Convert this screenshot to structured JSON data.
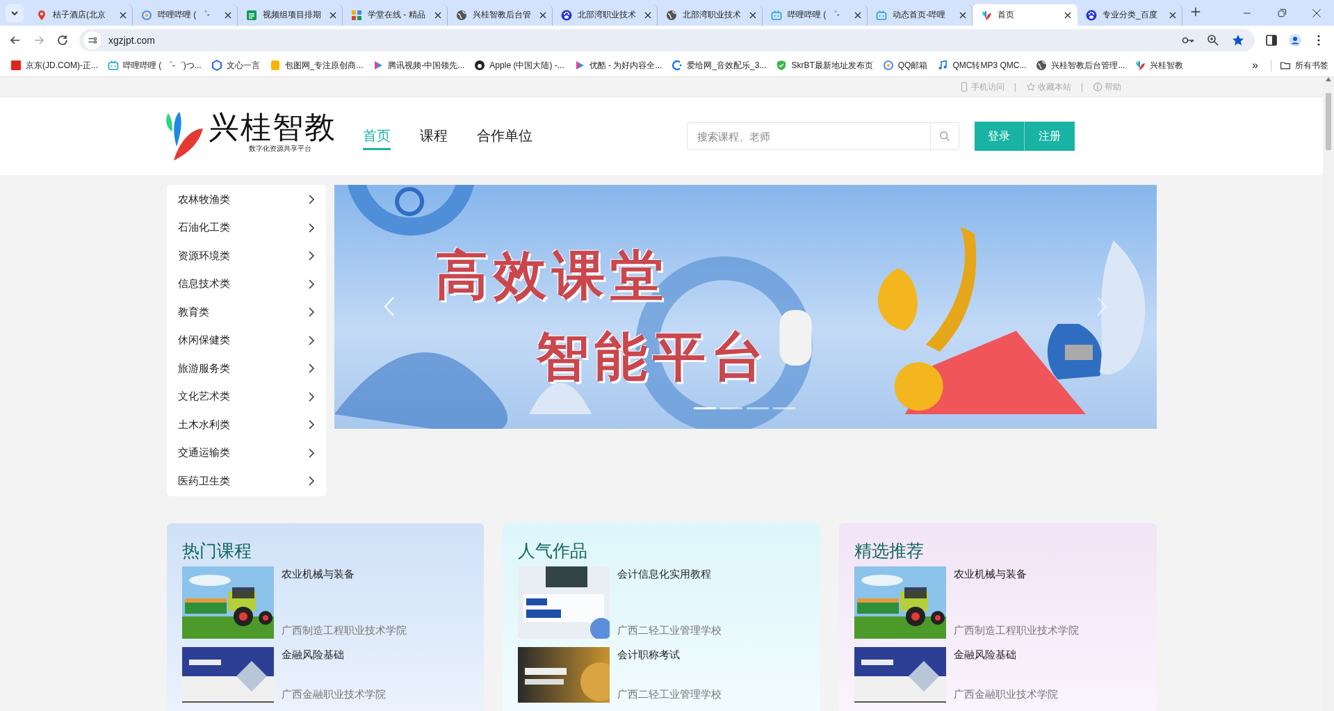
{
  "browser": {
    "tabs": [
      {
        "title": "桔子酒店(北京",
        "kind": "pin",
        "selected": false
      },
      {
        "title": "哔哩哔哩 ( ゜-",
        "kind": "ring",
        "selected": false
      },
      {
        "title": "视频组项目排期",
        "kind": "sheet",
        "selected": false
      },
      {
        "title": "学堂在线 - 精品",
        "kind": "grid",
        "selected": false
      },
      {
        "title": "兴桂智教后台管",
        "kind": "globe",
        "selected": false
      },
      {
        "title": "北部湾职业技术",
        "kind": "paw",
        "selected": false
      },
      {
        "title": "北部湾职业技术",
        "kind": "globe",
        "selected": false
      },
      {
        "title": "哔哩哔哩 ( ゜-",
        "kind": "tv",
        "selected": false
      },
      {
        "title": "动态首页-哔哩",
        "kind": "tv",
        "selected": false
      },
      {
        "title": "首页",
        "kind": "leaf",
        "selected": true
      },
      {
        "title": "专业分类_百度",
        "kind": "paw",
        "selected": false
      }
    ],
    "url": "xgzjpt.com",
    "bookmarks": [
      {
        "label": "京东(JD.COM)-正...",
        "kind": "square"
      },
      {
        "label": "哔哩哔哩 ( ゜-゜)つ...",
        "kind": "tv"
      },
      {
        "label": "文心一言",
        "kind": "cube"
      },
      {
        "label": "包图网_专注原创商...",
        "kind": "tile"
      },
      {
        "label": "腾讯视频-中国领先...",
        "kind": "play"
      },
      {
        "label": "Apple (中国大陆) -...",
        "kind": "dot"
      },
      {
        "label": "优酷 - 为好内容全...",
        "kind": "play"
      },
      {
        "label": "爱给网_音效配乐_3...",
        "kind": "arc"
      },
      {
        "label": "SkrBT最新地址发布页",
        "kind": "shield"
      },
      {
        "label": "QQ邮箱",
        "kind": "ring"
      },
      {
        "label": "QMC转MP3 QMC...",
        "kind": "note"
      },
      {
        "label": "兴桂智教后台管理...",
        "kind": "globe"
      },
      {
        "label": "兴桂智教",
        "kind": "leaf"
      }
    ],
    "more": "»",
    "all_bookmarks": "所有书签"
  },
  "topbar": {
    "links": [
      "手机访问",
      "收藏本站",
      "帮助"
    ],
    "separator": "|"
  },
  "header": {
    "logo": {
      "name": "兴桂智教",
      "tagline": "数字化资源共享平台"
    },
    "nav": [
      {
        "label": "首页",
        "selected": true
      },
      {
        "label": "课程",
        "selected": false
      },
      {
        "label": "合作单位",
        "selected": false
      }
    ],
    "search": {
      "placeholder": "搜索课程、老师"
    },
    "buttons": [
      "登录",
      "注册"
    ]
  },
  "categories": [
    "农林牧渔类",
    "石油化工类",
    "资源环境类",
    "信息技术类",
    "教育类",
    "休闲保健类",
    "旅游服务类",
    "文化艺术类",
    "土木水利类",
    "交通运输类",
    "医药卫生类"
  ],
  "banner": {
    "headline": [
      "高效课堂",
      "智能平台"
    ],
    "dots": [
      {
        "selected": true
      },
      {
        "selected": false
      },
      {
        "selected": false
      },
      {
        "selected": false
      }
    ]
  },
  "sections": [
    {
      "title": "热门课程",
      "kind": "blue",
      "items": [
        {
          "title": "农业机械与装备",
          "school": "广西制造工程职业技术学院",
          "kind": "tractor"
        },
        {
          "title": "金融风险基础",
          "school": "广西金融职业技术学院",
          "kind": "slide"
        }
      ]
    },
    {
      "title": "人气作品",
      "kind": "cyan",
      "items": [
        {
          "title": "会计信息化实用教程",
          "school": "广西二轻工业管理学校",
          "kind": "office"
        },
        {
          "title": "会计职称考试",
          "school": "广西二轻工业管理学校",
          "kind": "gold"
        }
      ]
    },
    {
      "title": "精选推荐",
      "kind": "violet",
      "items": [
        {
          "title": "农业机械与装备",
          "school": "广西制造工程职业技术学院",
          "kind": "tractor"
        },
        {
          "title": "金融风险基础",
          "school": "广西金融职业技术学院",
          "kind": "slide"
        }
      ]
    }
  ]
}
